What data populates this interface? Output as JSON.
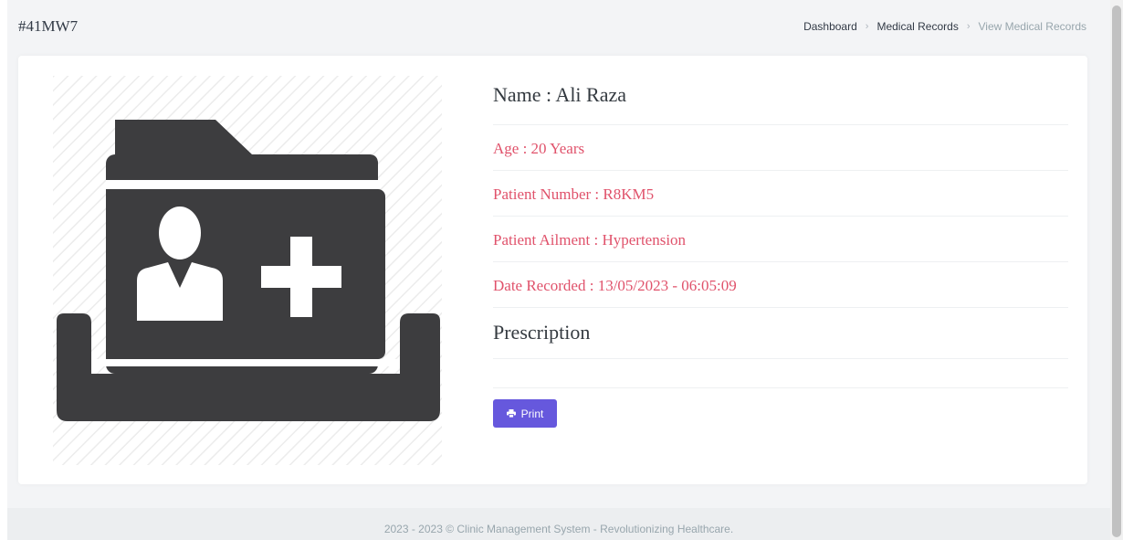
{
  "header": {
    "code": "#41MW7",
    "breadcrumb": [
      {
        "label": "Dashboard"
      },
      {
        "label": "Medical Records"
      },
      {
        "label": "View Medical Records"
      }
    ]
  },
  "record": {
    "name_label": "Name : Ali Raza",
    "age_label": "Age : 20 Years",
    "patient_number_label": "Patient Number : R8KM5",
    "ailment_label": "Patient Ailment : Hypertension",
    "date_recorded_label": "Date Recorded : 13/05/2023 - 06:05:09",
    "prescription_heading": "Prescription",
    "prescription_text": ""
  },
  "actions": {
    "print_label": "Print"
  },
  "colors": {
    "accent": "#6658dd",
    "highlight_text": "#e0526b",
    "icon_fill": "#3d3d3f"
  },
  "icons": {
    "illustration": "medical-folder-patient-plus-icon",
    "print": "printer-icon"
  },
  "footer": {
    "text": "2023 - 2023 © Clinic Management System - Revolutionizing Healthcare."
  }
}
